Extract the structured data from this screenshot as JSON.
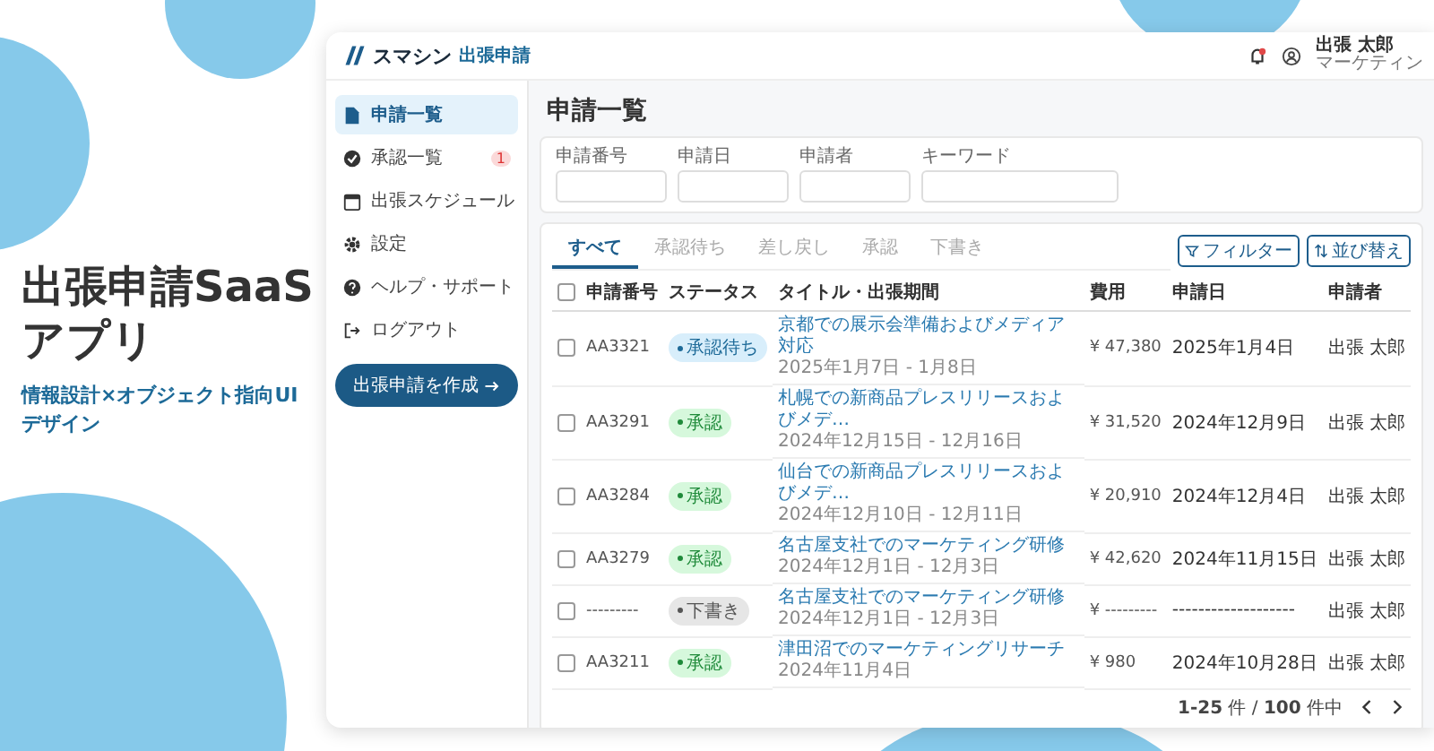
{
  "hero": {
    "title": "出張申請SaaSアプリ",
    "subtitle": "情報設計×オブジェクト指向UIデザイン"
  },
  "app": {
    "brand": "スマシン",
    "brand_tag": "出張申請",
    "user": {
      "name": "出張 太郎",
      "department": "マーケティン"
    }
  },
  "sidebar": {
    "items": [
      {
        "label": "申請一覧",
        "kind": "document",
        "selected": true
      },
      {
        "label": "承認一覧",
        "kind": "check",
        "selected": false,
        "badge": "1"
      },
      {
        "label": "出張スケジュール",
        "kind": "calendar",
        "selected": false
      },
      {
        "label": "設定",
        "kind": "gear",
        "selected": false
      },
      {
        "label": "ヘルプ・サポート",
        "kind": "help",
        "selected": false
      },
      {
        "label": "ログアウト",
        "kind": "logout",
        "selected": false
      }
    ],
    "create_button": "出張申請を作成"
  },
  "page_title": "申請一覧",
  "search_fields": [
    {
      "label": "申請番号"
    },
    {
      "label": "申請日"
    },
    {
      "label": "申請者"
    },
    {
      "label": "キーワード"
    }
  ],
  "tabs": [
    {
      "label": "すべて",
      "selected": true
    },
    {
      "label": "承認待ち",
      "selected": false
    },
    {
      "label": "差し戻し",
      "selected": false
    },
    {
      "label": "承認",
      "selected": false
    },
    {
      "label": "下書き",
      "selected": false
    }
  ],
  "toolbar": {
    "filter": "フィルター",
    "sort": "並び替え"
  },
  "table": {
    "select_all_checked": false,
    "columns": [
      "申請番号",
      "ステータス",
      "タイトル・出張期間",
      "費用",
      "申請日",
      "申請者"
    ],
    "rows": [
      {
        "checked": false,
        "number": "AA3321",
        "status": {
          "kind": "pending",
          "label": "承認待ち"
        },
        "title": "京都での展示会準備およびメディア対応",
        "period": "2025年1月7日 - 1月8日",
        "cost": "¥ 47,380",
        "date": "2025年1月4日",
        "applicant": "出張 太郎"
      },
      {
        "checked": false,
        "number": "AA3291",
        "status": {
          "kind": "approved",
          "label": "承認"
        },
        "title": "札幌での新商品プレスリリースおよびメデ…",
        "period": "2024年12月15日 - 12月16日",
        "cost": "¥ 31,520",
        "date": "2024年12月9日",
        "applicant": "出張 太郎"
      },
      {
        "checked": false,
        "number": "AA3284",
        "status": {
          "kind": "approved",
          "label": "承認"
        },
        "title": "仙台での新商品プレスリリースおよびメデ…",
        "period": "2024年12月10日 - 12月11日",
        "cost": "¥ 20,910",
        "date": "2024年12月4日",
        "applicant": "出張 太郎"
      },
      {
        "checked": false,
        "number": "AA3279",
        "status": {
          "kind": "approved",
          "label": "承認"
        },
        "title": "名古屋支社でのマーケティング研修",
        "period": "2024年12月1日 - 12月3日",
        "cost": "¥ 42,620",
        "date": "2024年11月15日",
        "applicant": "出張 太郎"
      },
      {
        "checked": false,
        "number": "---------",
        "status": {
          "kind": "draft",
          "label": "下書き"
        },
        "title": "名古屋支社でのマーケティング研修",
        "period": "2024年12月1日 - 12月3日",
        "cost": "¥ ---------",
        "date": "-------------------",
        "applicant": "出張 太郎"
      },
      {
        "checked": false,
        "number": "AA3211",
        "status": {
          "kind": "approved",
          "label": "承認"
        },
        "title": "津田沼でのマーケティングリサーチ",
        "period": "2024年11月4日",
        "cost": "¥ 980",
        "date": "2024年10月28日",
        "applicant": "出張 太郎"
      }
    ]
  },
  "pagination": "**1-25** 件 / **100** 件中"
}
